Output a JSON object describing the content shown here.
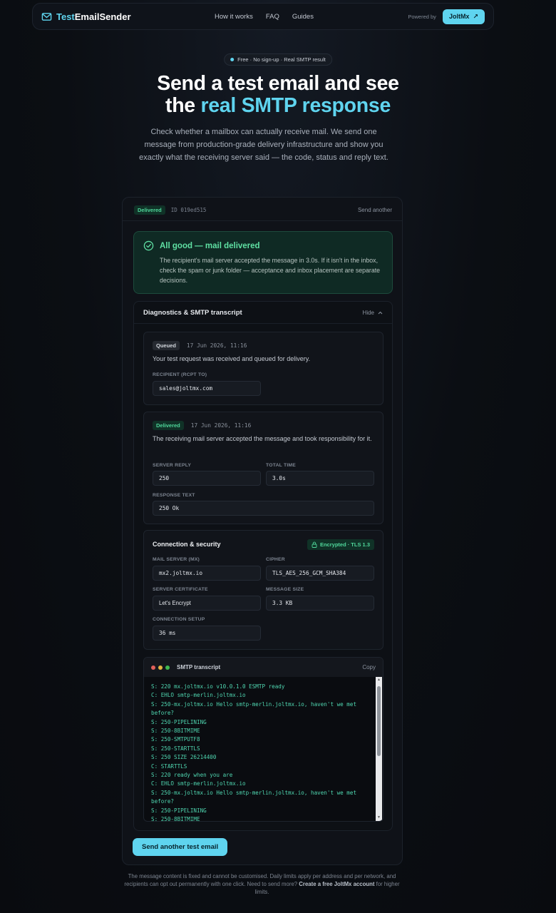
{
  "nav": {
    "logo_part1": "Test",
    "logo_part2": "EmailSender",
    "links": [
      "How it works",
      "FAQ",
      "Guides"
    ],
    "powered_by": "Powered by",
    "brand_button": "JoltMx",
    "brand_arrow": "↗"
  },
  "hero": {
    "pill": "Free · No sign-up · Real SMTP result",
    "title_line1": "Send a test email and see",
    "title_line2_plain": "the ",
    "title_line2_accent": "real SMTP response",
    "subtitle": "Check whether a mailbox can actually receive mail. We send one message from production-grade delivery infrastructure and show you exactly what the receiving server said — the code, status and reply text."
  },
  "result": {
    "status_badge": "Delivered",
    "id_text": "ID 019ed515",
    "send_another_link": "Send another",
    "success_title": "All good — mail delivered",
    "success_body": "The recipient's mail server accepted the message in 3.0s. If it isn't in the inbox, check the spam or junk folder — acceptance and inbox placement are separate decisions."
  },
  "diagnostics": {
    "title": "Diagnostics & SMTP transcript",
    "hide_label": "Hide",
    "queued": {
      "badge": "Queued",
      "time": "17 Jun 2026, 11:16",
      "text": "Your test request was received and queued for delivery.",
      "recipient_label": "RECIPIENT (RCPT TO)",
      "recipient_value": "sales@joltmx.com"
    },
    "delivered": {
      "badge": "Delivered",
      "time": "17 Jun 2026, 11:16",
      "text": "The receiving mail server accepted the message and took responsibility for it.",
      "server_reply_label": "SERVER REPLY",
      "server_reply_value": "250",
      "total_time_label": "TOTAL TIME",
      "total_time_value": "3.0s",
      "response_text_label": "RESPONSE TEXT",
      "response_text_value": "250 Ok"
    },
    "security": {
      "title": "Connection & security",
      "badge": "Encrypted · TLS 1.3",
      "mx_label": "MAIL SERVER (MX)",
      "mx_value": "mx2.joltmx.io",
      "cipher_label": "CIPHER",
      "cipher_value": "TLS_AES_256_GCM_SHA384",
      "cert_label": "SERVER CERTIFICATE",
      "cert_value": "Let's Encrypt",
      "size_label": "MESSAGE SIZE",
      "size_value": "3.3 KB",
      "setup_label": "CONNECTION SETUP",
      "setup_value": "36 ms"
    },
    "transcript": {
      "title": "SMTP transcript",
      "copy_label": "Copy",
      "dot_colors": [
        "#e0605a",
        "#e3b341",
        "#3fb950"
      ],
      "body": "S: 220 mx.joltmx.io v10.0.1.0 ESMTP ready\nC: EHLO smtp-merlin.joltmx.io\nS: 250-mx.joltmx.io Hello smtp-merlin.joltmx.io, haven't we met before?\nS: 250-PIPELINING\nS: 250-8BITMIME\nS: 250-SMTPUTF8\nS: 250-STARTTLS\nS: 250 SIZE 26214400\nC: STARTTLS\nS: 220 ready when you are\nC: EHLO smtp-merlin.joltmx.io\nS: 250-mx.joltmx.io Hello smtp-merlin.joltmx.io, haven't we met before?\nS: 250-PIPELINING\nS: 250-8BITMIME"
    }
  },
  "cta": {
    "label": "Send another test email"
  },
  "footer": {
    "text_before": "The message content is fixed and cannot be customised. Daily limits apply per address and per network, and recipients can opt out permanently with one click. Need to send more? ",
    "link": "Create a free JoltMx account",
    "text_after": " for higher limits."
  },
  "colors": {
    "accent": "#5fd4ef",
    "success": "#4fd69a",
    "background": "#0b0e13"
  }
}
